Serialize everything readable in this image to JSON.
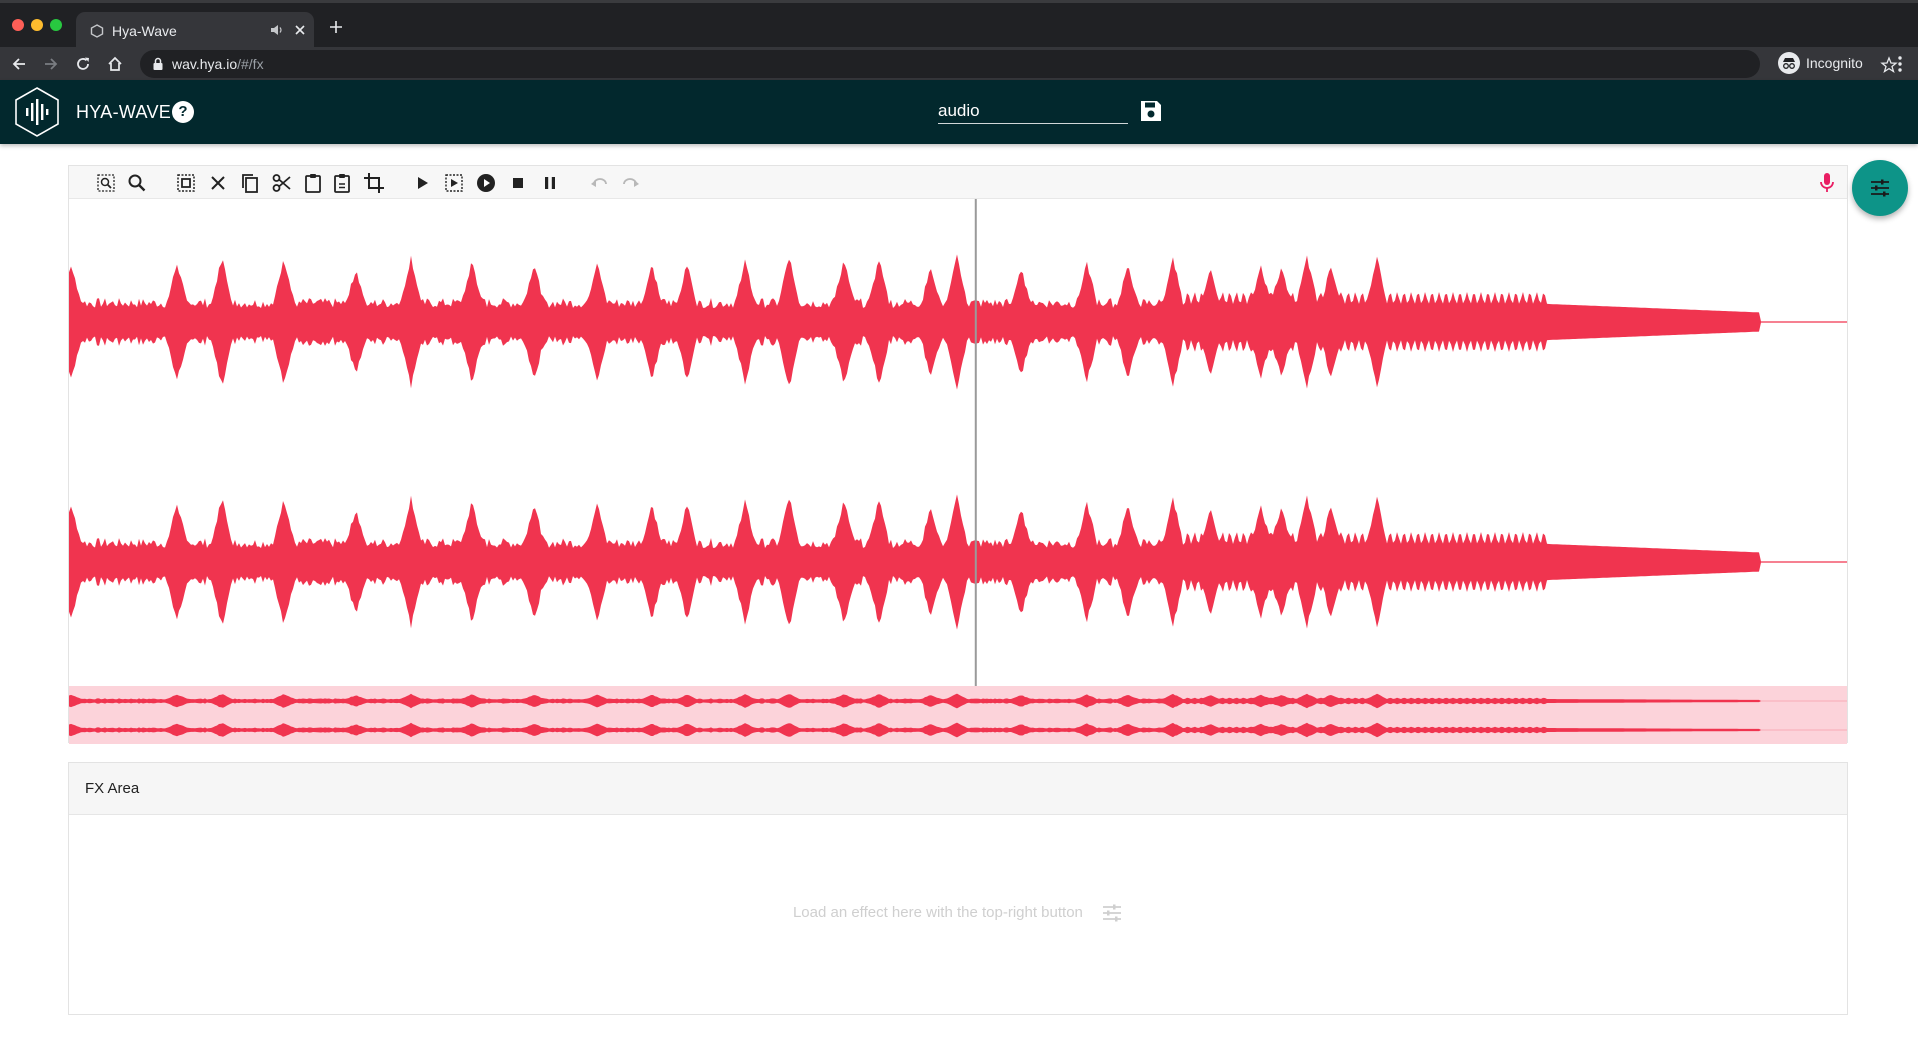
{
  "browser": {
    "tab_title": "Hya-Wave",
    "url_host": "wav.hya.io",
    "url_path": "/#/fx",
    "profile_label": "Incognito"
  },
  "app": {
    "title": "HYA-WAVE",
    "help_label": "?",
    "filename_value": "audio"
  },
  "colors": {
    "header_bg": "#02282d",
    "waveform": "#f0344f",
    "overview_bg": "#fcd3da",
    "fab": "#0d9488",
    "mic": "#e91e63"
  },
  "toolbar": {
    "icons": [
      "select-region-icon",
      "zoom-icon",
      "select-all-icon",
      "clear-selection-icon",
      "copy-icon",
      "cut-icon",
      "paste-icon",
      "paste-new-icon",
      "crop-icon",
      "play-icon",
      "play-selection-icon",
      "play-loop-icon",
      "stop-icon",
      "pause-icon",
      "undo-icon",
      "redo-icon"
    ]
  },
  "waveform": {
    "channels": 2,
    "playhead_fraction": 0.51
  },
  "fx": {
    "title": "FX Area",
    "hint": "Load an effect here with the top-right button"
  }
}
